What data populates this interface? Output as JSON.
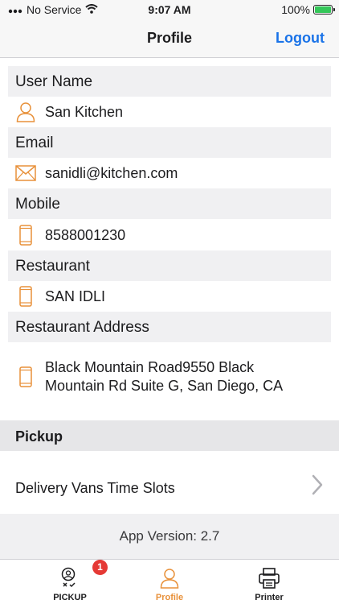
{
  "status_bar": {
    "carrier": "No Service",
    "time": "9:07 AM",
    "battery": "100%",
    "battery_level": 1.0
  },
  "nav": {
    "title": "Profile",
    "logout_label": "Logout"
  },
  "profile": {
    "fields": [
      {
        "label": "User Name",
        "value": "San Kitchen",
        "icon": "user-icon"
      },
      {
        "label": "Email",
        "value": "sanidli@kitchen.com",
        "icon": "mail-icon"
      },
      {
        "label": "Mobile",
        "value": "8588001230",
        "icon": "phone-icon"
      },
      {
        "label": "Restaurant",
        "value": "SAN IDLI",
        "icon": "phone-icon"
      },
      {
        "label": "Restaurant Address",
        "value": "Black Mountain Road9550 Black Mountain Rd Suite G, San Diego, CA",
        "icon": "phone-icon"
      }
    ]
  },
  "pickup": {
    "header": "Pickup",
    "slots_label": "Delivery Vans Time Slots"
  },
  "app_version": "App Version: 2.7",
  "tabs": [
    {
      "label": "PICKUP",
      "icon": "pickup-icon",
      "badge": "1"
    },
    {
      "label": "Profile",
      "icon": "profile-icon",
      "active": true
    },
    {
      "label": "Printer",
      "icon": "printer-icon"
    }
  ],
  "colors": {
    "accent": "#e8913a",
    "link": "#1a73e8",
    "badge": "#e53935",
    "battery": "#34c759"
  }
}
